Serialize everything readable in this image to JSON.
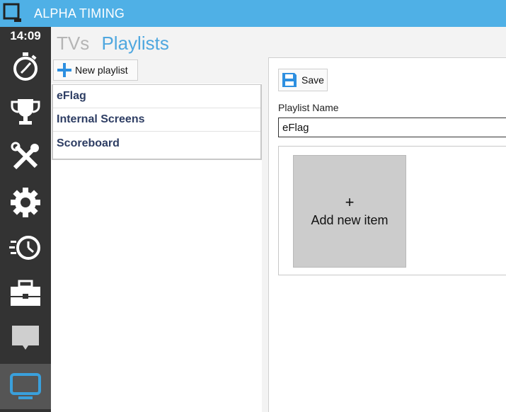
{
  "app": {
    "title": "ALPHA TIMING",
    "accent_color": "#4fb0e6"
  },
  "nav": {
    "clock": "14:09",
    "items": [
      {
        "name": "stopwatch-icon"
      },
      {
        "name": "trophy-icon"
      },
      {
        "name": "tools-icon"
      },
      {
        "name": "gear-icon"
      },
      {
        "name": "history-icon"
      },
      {
        "name": "toolbox-icon"
      },
      {
        "name": "chat-icon"
      },
      {
        "name": "monitor-icon",
        "active": true
      }
    ]
  },
  "header": {
    "tabs": [
      {
        "label": "TVs",
        "active": false
      },
      {
        "label": "Playlists",
        "active": true
      }
    ]
  },
  "playlists": {
    "new_button_label": "New playlist",
    "items": [
      {
        "label": "eFlag"
      },
      {
        "label": "Internal Screens"
      },
      {
        "label": "Scoreboard"
      }
    ]
  },
  "editor": {
    "save_label": "Save",
    "name_label": "Playlist Name",
    "name_value": "eFlag",
    "add_item_plus": "+",
    "add_item_label": "Add new item"
  }
}
